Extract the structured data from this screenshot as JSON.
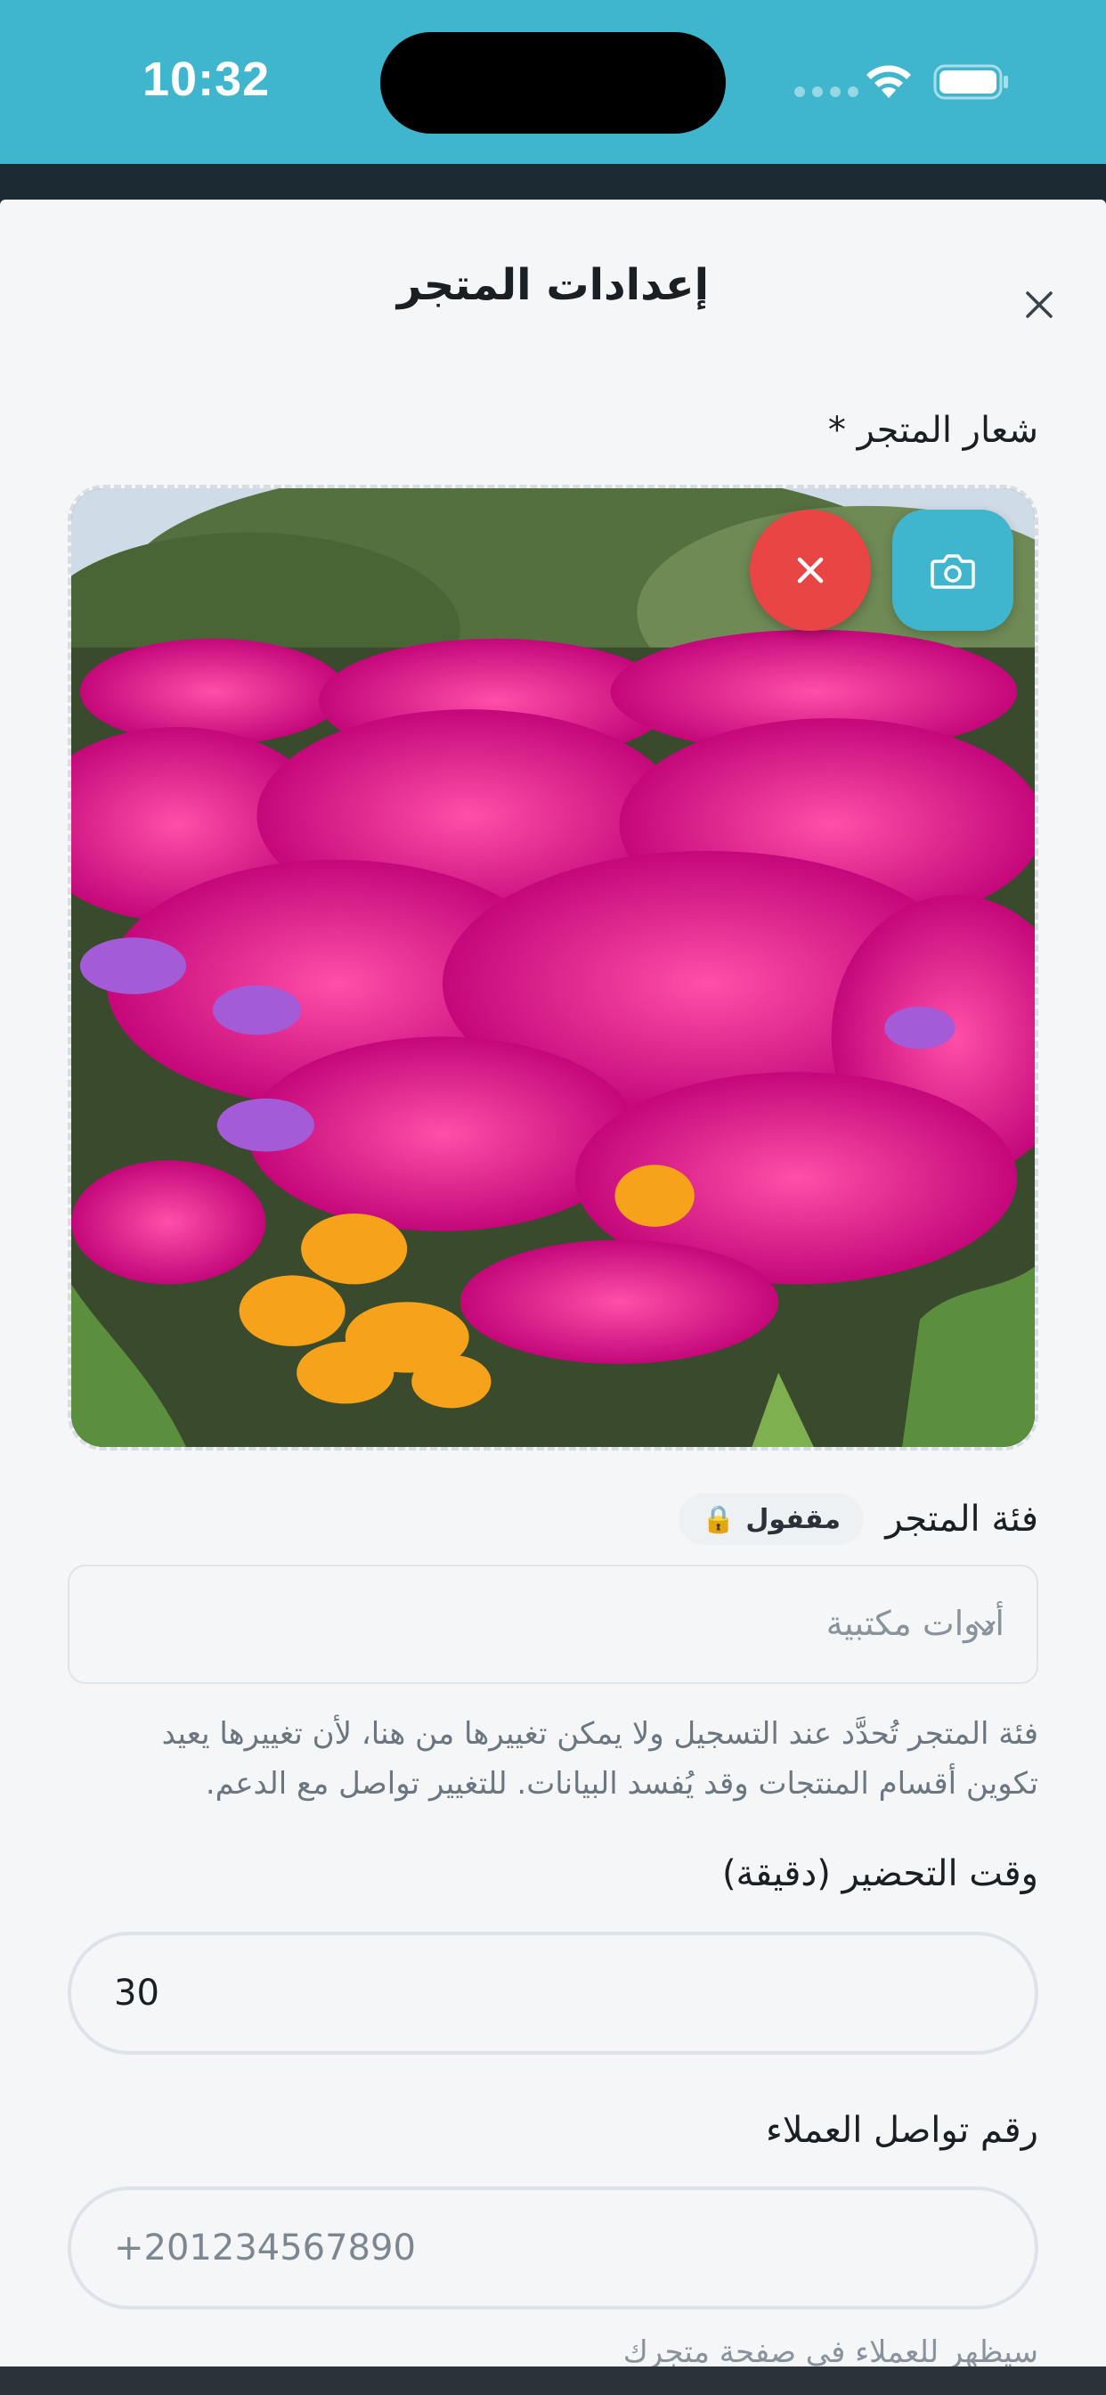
{
  "status_bar": {
    "time": "10:32",
    "background_color": "#3fb6cd"
  },
  "sheet": {
    "title": "إعدادات المتجر",
    "close_icon": "close-icon"
  },
  "logo_field": {
    "label": "شعار المتجر *",
    "image_description_icon": "photo",
    "remove_button_icon": "close-icon",
    "camera_button_icon": "camera-icon",
    "remove_button_color": "#ea4545",
    "camera_button_color": "#3fb6cd"
  },
  "category_field": {
    "label": "فئة المتجر",
    "lock_badge_label": "مقفول",
    "lock_badge_icon": "🔒",
    "selected_value": "أدوات مكتبية",
    "helper_text": "فئة المتجر تُحدَّد عند التسجيل ولا يمكن تغييرها من هنا، لأن تغييرها يعيد تكوين أقسام المنتجات وقد يُفسد البيانات. للتغيير تواصل مع الدعم."
  },
  "prep_time_field": {
    "label": "وقت التحضير (دقيقة)",
    "value": "30"
  },
  "contact_field": {
    "label": "رقم تواصل العملاء",
    "placeholder": "+201234567890",
    "helper_cut": "سيظهر للعملاء في صفحة متجرك"
  }
}
